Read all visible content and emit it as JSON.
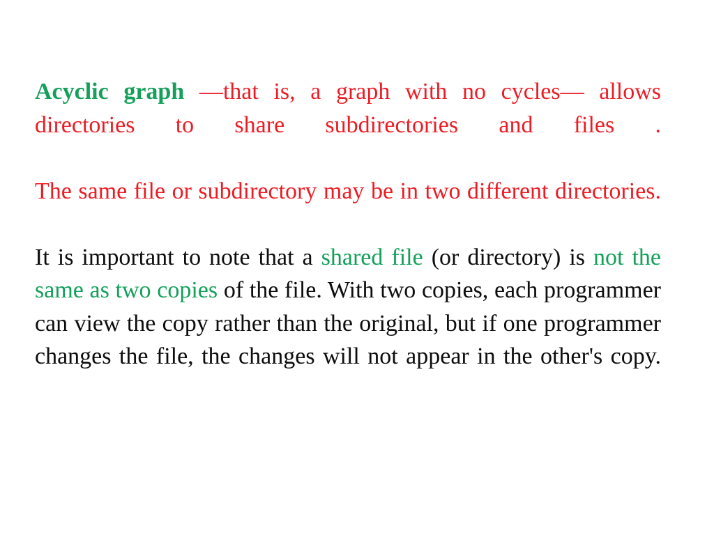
{
  "slide": {
    "background_color": "#ffffff",
    "colors": {
      "red": "#ec1c24",
      "green": "#14a05a",
      "black": "#0d0d0d"
    },
    "paragraphs": [
      {
        "id": "para-acyclic",
        "runs": [
          {
            "text": "Acyclic graph",
            "color": "green",
            "bold": true
          },
          {
            "text": " —that is, a graph with no cycles— allows directories to share subdirectories and files .",
            "color": "red",
            "bold": false
          }
        ]
      },
      {
        "id": "para-samefile",
        "runs": [
          {
            "text": "The same file or subdirectory may be in two different directories.",
            "color": "red",
            "bold": false
          }
        ]
      },
      {
        "id": "para-shared",
        "runs": [
          {
            "text": "It is important to note that a ",
            "color": "black",
            "bold": false
          },
          {
            "text": "shared file",
            "color": "green",
            "bold": false
          },
          {
            "text": " (or directory) is ",
            "color": "black",
            "bold": false
          },
          {
            "text": "not the same as two copies",
            "color": "green",
            "bold": false
          },
          {
            "text": " of the file. With two copies, each programmer can view the copy rather than the original, but if one programmer changes the file, the changes will not appear in the other's copy.",
            "color": "black",
            "bold": false
          }
        ]
      }
    ],
    "text": {
      "p1_term": "Acyclic graph",
      "p1_rest": " —that is, a graph with no cycles— allows directories to share subdirectories and files .",
      "p2": "The same file or subdirectory may be in two different directories.",
      "p3_a": "It is important to note that a ",
      "p3_shared_file": "shared file",
      "p3_b": " (or directory) is ",
      "p3_not_same": "not the same as two copies",
      "p3_c": " of the file. With two copies, each programmer can view the copy rather than the original, but if one programmer changes the file, the changes will not appear in the other's copy."
    }
  }
}
